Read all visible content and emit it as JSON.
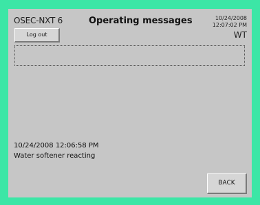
{
  "header": {
    "app_name": "OSEC-NXT 6",
    "title": "Operating messages",
    "date": "10/24/2008",
    "time": "12:07:02 PM",
    "user": "WT"
  },
  "buttons": {
    "logout_label": "Log out",
    "back_label": "BACK"
  },
  "message": {
    "timestamp": "10/24/2008 12:06:58 PM",
    "text": "Water softener reacting"
  },
  "colors": {
    "frame": "#3ce6a6",
    "panel": "#c6c6c6"
  }
}
